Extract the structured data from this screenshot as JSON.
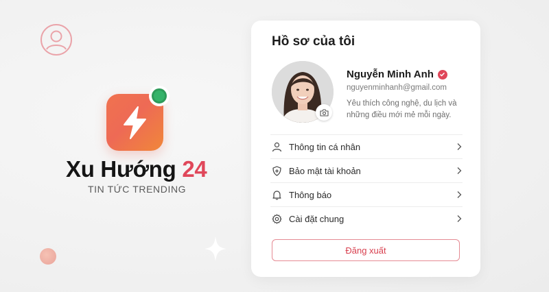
{
  "brand": {
    "name_text": "Xu Hướng",
    "name_number": "24",
    "tagline": "TIN TỨC TRENDING",
    "accent_color": "#e0475a",
    "icon": "lightning-bolt-icon",
    "status_color": "#35b36a"
  },
  "profile": {
    "title": "Hồ sơ của tôi",
    "name": "Nguyễn Minh Anh",
    "email": "nguyenminhanh@gmail.com",
    "bio": "Yêu thích công nghệ, du lịch và những điều mới mẻ mỗi ngày.",
    "verified_icon": "verified-check-icon",
    "camera_icon": "camera-icon"
  },
  "menu": [
    {
      "label": "Thông tin cá nhân",
      "icon": "user-icon"
    },
    {
      "label": "Bảo mật tài khoản",
      "icon": "shield-icon"
    },
    {
      "label": "Thông báo",
      "icon": "bell-icon"
    },
    {
      "label": "Cài đặt chung",
      "icon": "gear-icon"
    }
  ],
  "logout_label": "Đăng xuất"
}
